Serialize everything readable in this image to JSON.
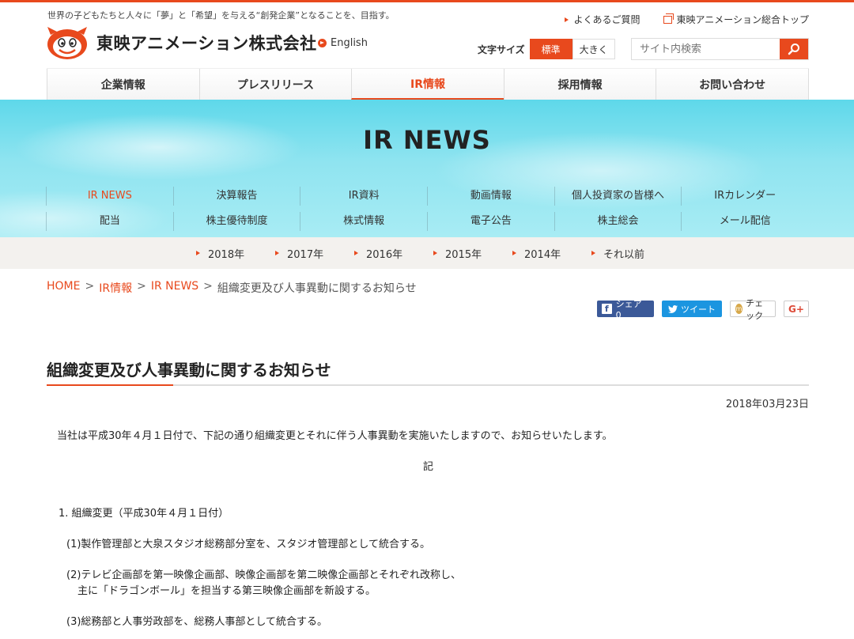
{
  "header": {
    "tagline": "世界の子どもたちと人々に「夢」と「希望」を与える“創発企業”となることを、目指す。",
    "company_name": "東映アニメーション株式会社",
    "english_link": "English",
    "faq_link": "よくあるご質問",
    "group_link": "東映アニメーション総合トップ",
    "font_size_label": "文字サイズ",
    "font_size_standard": "標準",
    "font_size_large": "大きく",
    "search_placeholder": "サイト内検索"
  },
  "global_nav": [
    {
      "label": "企業情報"
    },
    {
      "label": "プレスリリース"
    },
    {
      "label": "IR情報"
    },
    {
      "label": "採用情報"
    },
    {
      "label": "お問い合わせ"
    }
  ],
  "hero": {
    "title": "IR NEWS",
    "subnav_row1": [
      {
        "label": "IR NEWS"
      },
      {
        "label": "決算報告"
      },
      {
        "label": "IR資料"
      },
      {
        "label": "動画情報"
      },
      {
        "label": "個人投資家の皆様へ"
      },
      {
        "label": "IRカレンダー"
      }
    ],
    "subnav_row2": [
      {
        "label": "配当"
      },
      {
        "label": "株主優待制度"
      },
      {
        "label": "株式情報"
      },
      {
        "label": "電子公告"
      },
      {
        "label": "株主総会"
      },
      {
        "label": "メール配信"
      }
    ]
  },
  "years": [
    {
      "label": "2018年"
    },
    {
      "label": "2017年"
    },
    {
      "label": "2016年"
    },
    {
      "label": "2015年"
    },
    {
      "label": "2014年"
    },
    {
      "label": "それ以前"
    }
  ],
  "breadcrumb": {
    "home": "HOME",
    "ir": "IR情報",
    "irnews": "IR NEWS",
    "sep": ">",
    "current": "組織変更及び人事異動に関するお知らせ"
  },
  "share": {
    "facebook": "シェア 0",
    "twitter": "ツイート",
    "mixi": "チェック",
    "gplus": "G+"
  },
  "article": {
    "title": "組織変更及び人事異動に関するお知らせ",
    "date": "2018年03月23日",
    "intro": "当社は平成30年４月１日付で、下記の通り組織変更とそれに伴う人事異動を実施いたしますので、お知らせいたします。",
    "ki": "記",
    "section1": "1. 組織変更（平成30年４月１日付）",
    "item1": "(1)製作管理部と大泉スタジオ総務部分室を、スタジオ管理部として統合する。",
    "item2a": "(2)テレビ企画部を第一映像企画部、映像企画部を第二映像企画部とそれぞれ改称し、",
    "item2b": "主に「ドラゴンボール」を担当する第三映像企画部を新設する。",
    "item3": "(3)総務部と人事労政部を、総務人事部として統合する。"
  },
  "colors": {
    "accent": "#e8491d",
    "hero_sky": "#5ed8ea",
    "year_bar": "#f3f1ee"
  }
}
